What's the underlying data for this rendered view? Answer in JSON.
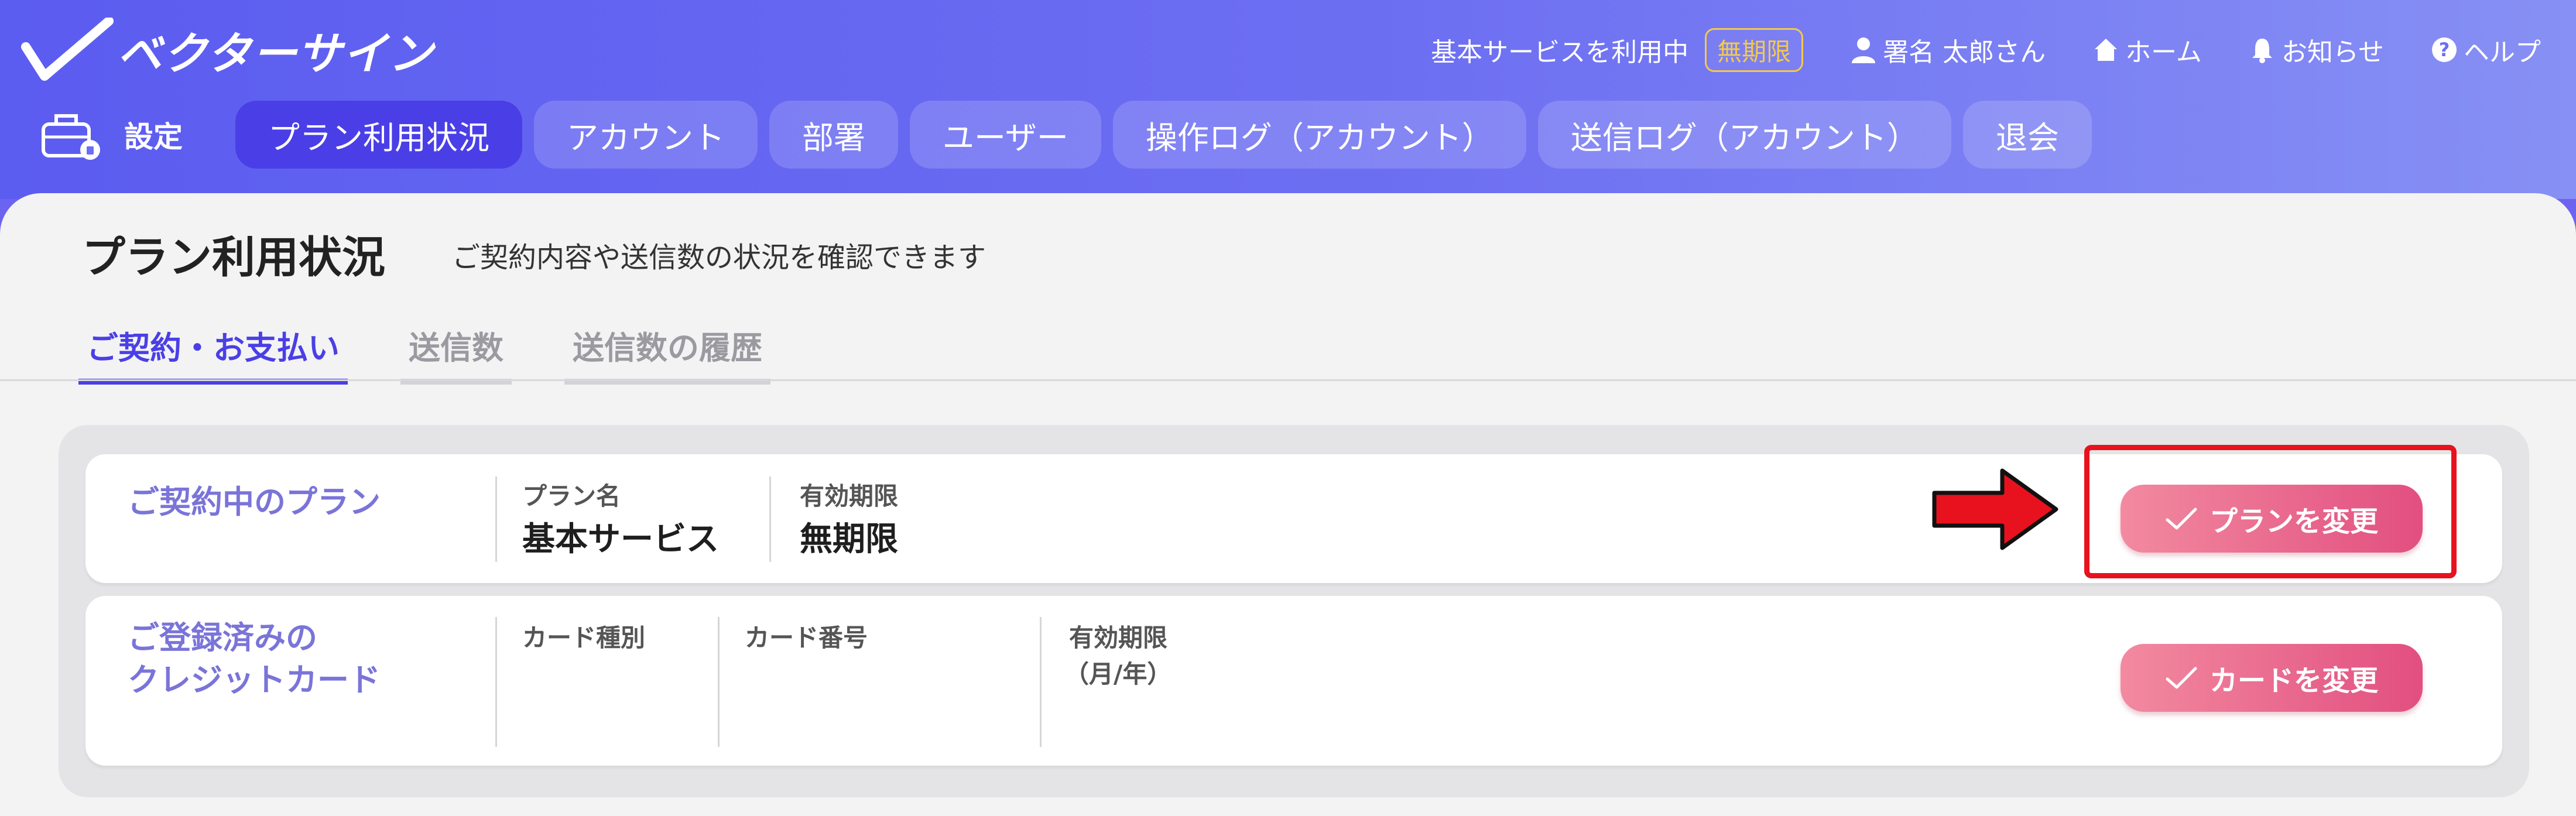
{
  "app": {
    "name": "ベクターサイン"
  },
  "topbar": {
    "service_text": "基本サービスを利用中",
    "badge": "無期限",
    "user": "署名 太郎さん",
    "home": "ホーム",
    "notice": "お知らせ",
    "help": "ヘルプ"
  },
  "nav": {
    "settings_label": "設定",
    "tabs": [
      {
        "label": "プラン利用状況",
        "active": true
      },
      {
        "label": "アカウント"
      },
      {
        "label": "部署"
      },
      {
        "label": "ユーザー"
      },
      {
        "label": "操作ログ（アカウント）"
      },
      {
        "label": "送信ログ（アカウント）"
      },
      {
        "label": "退会"
      }
    ]
  },
  "page": {
    "title": "プラン利用状況",
    "subtitle": "ご契約内容や送信数の状況を確認できます",
    "subtabs": [
      {
        "label": "ご契約・お支払い",
        "active": true
      },
      {
        "label": "送信数"
      },
      {
        "label": "送信数の履歴"
      }
    ]
  },
  "plan_card": {
    "title": "ご契約中のプラン",
    "plan_name_label": "プラン名",
    "plan_name_value": "基本サービス",
    "expiry_label": "有効期限",
    "expiry_value": "無期限",
    "button": "プランを変更"
  },
  "card_card": {
    "title_line1": "ご登録済みの",
    "title_line2": "クレジットカード",
    "type_label": "カード種別",
    "number_label": "カード番号",
    "expiry_label_line1": "有効期限",
    "expiry_label_line2": "（月/年）",
    "button": "カードを変更"
  },
  "colors": {
    "accent": "#4a3fe6",
    "highlight": "#e8121e",
    "button_pink": "#e24f80",
    "badge": "#f2c94c"
  }
}
